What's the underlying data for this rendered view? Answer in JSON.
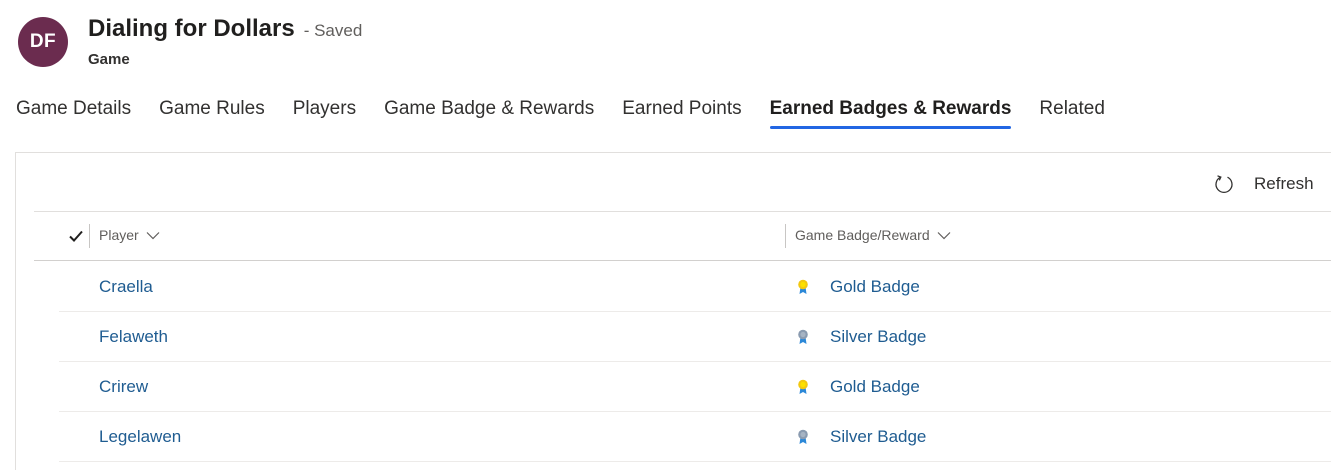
{
  "header": {
    "avatar_initials": "DF",
    "avatar_color": "#6b2c4f",
    "title": "Dialing for Dollars",
    "saved_status": "- Saved",
    "entity_type": "Game"
  },
  "tabs": [
    {
      "label": "Game Details",
      "active": false
    },
    {
      "label": "Game Rules",
      "active": false
    },
    {
      "label": "Players",
      "active": false
    },
    {
      "label": "Game Badge & Rewards",
      "active": false
    },
    {
      "label": "Earned Points",
      "active": false
    },
    {
      "label": "Earned Badges & Rewards",
      "active": true
    },
    {
      "label": "Related",
      "active": false
    }
  ],
  "accent_color": "#2266e3",
  "link_color": "#1f5c91",
  "toolbar": {
    "refresh_label": "Refresh",
    "refresh_icon": "refresh-icon"
  },
  "grid": {
    "columns": [
      {
        "label": "Player",
        "icon": "chevron-down-icon"
      },
      {
        "label": "Game Badge/Reward",
        "icon": "chevron-down-icon"
      }
    ],
    "rows": [
      {
        "player": "Craella",
        "badge": "Gold Badge",
        "badge_icon": "gold-badge-icon",
        "badge_color": "#f2c811"
      },
      {
        "player": "Felaweth",
        "badge": "Silver Badge",
        "badge_icon": "silver-badge-icon",
        "badge_color": "#8a9bb0"
      },
      {
        "player": "Crirew",
        "badge": "Gold Badge",
        "badge_icon": "gold-badge-icon",
        "badge_color": "#f2c811"
      },
      {
        "player": "Legelawen",
        "badge": "Silver Badge",
        "badge_icon": "silver-badge-icon",
        "badge_color": "#8a9bb0"
      }
    ]
  }
}
